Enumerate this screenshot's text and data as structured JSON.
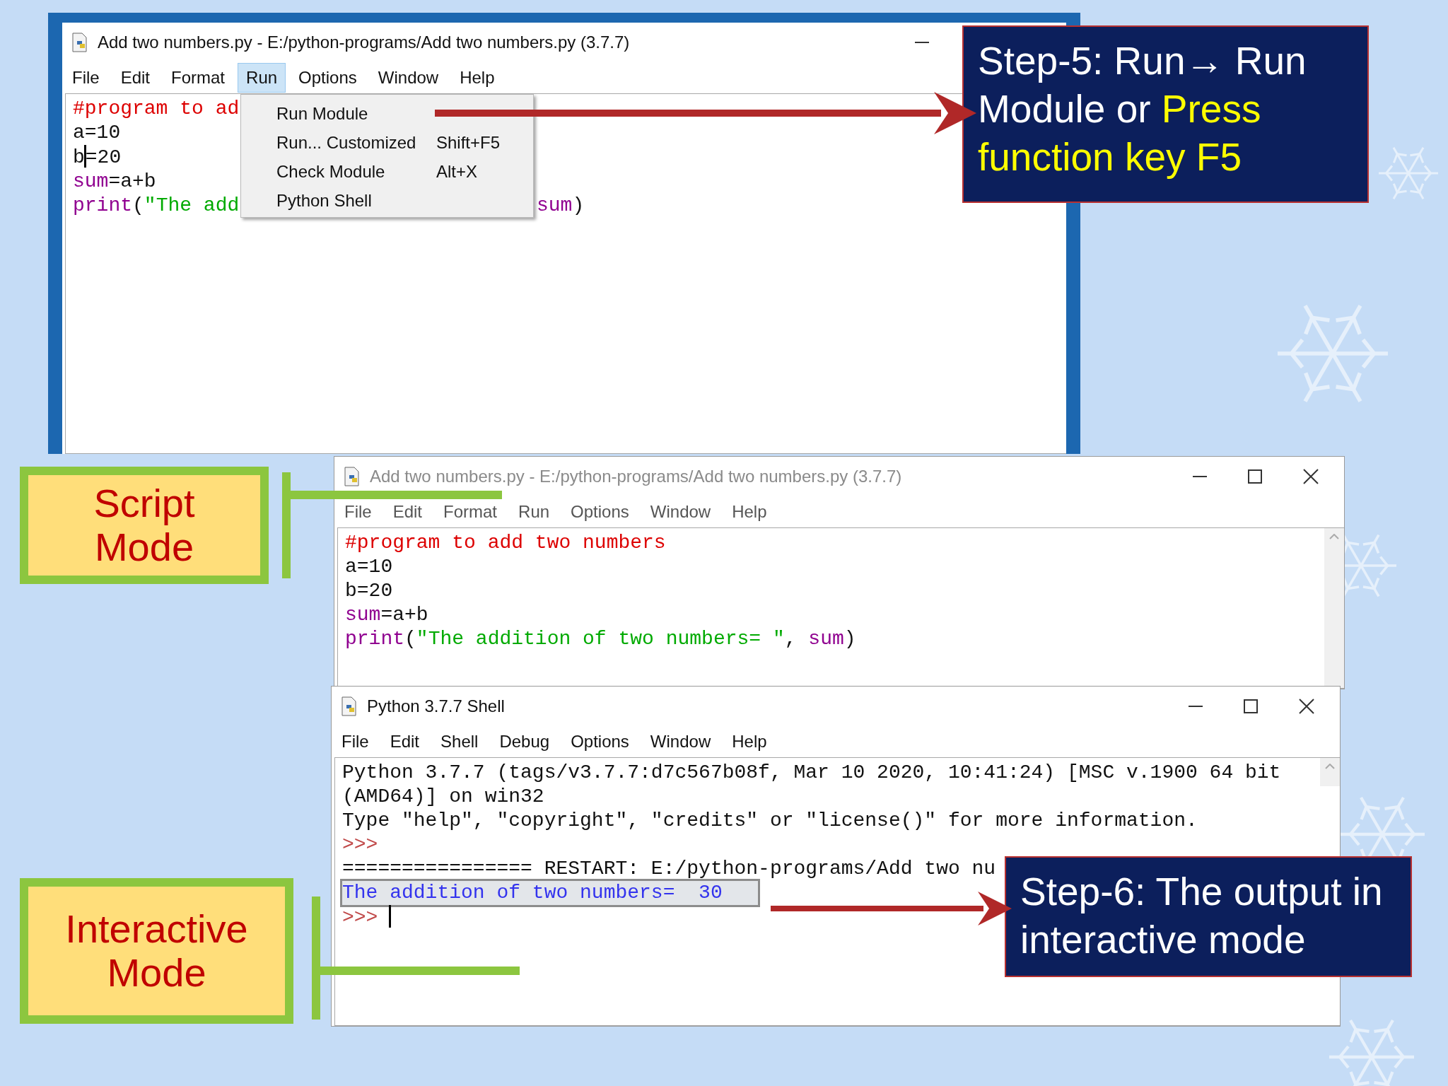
{
  "editor_window": {
    "title": "Add two numbers.py - E:/python-programs/Add two numbers.py (3.7.7)",
    "active": true,
    "menu": [
      {
        "label": "File",
        "selected": false
      },
      {
        "label": "Edit",
        "selected": false
      },
      {
        "label": "Format",
        "selected": false
      },
      {
        "label": "Run",
        "selected": true
      },
      {
        "label": "Options",
        "selected": false
      },
      {
        "label": "Window",
        "selected": false
      },
      {
        "label": "Help",
        "selected": false
      }
    ],
    "code_lines": [
      {
        "tokens": [
          {
            "text": "#program to ad",
            "kind": "comment"
          }
        ]
      },
      {
        "tokens": [
          {
            "text": "a=10",
            "kind": "plain"
          }
        ]
      },
      {
        "tokens": [
          {
            "text": "b",
            "kind": "plain"
          },
          {
            "kind": "cursor"
          },
          {
            "text": "=20",
            "kind": "plain"
          }
        ]
      },
      {
        "tokens": [
          {
            "text": "sum",
            "kind": "builtin"
          },
          {
            "text": "=a+b",
            "kind": "plain"
          }
        ]
      },
      {
        "tokens": [
          {
            "text": "print",
            "kind": "builtin"
          },
          {
            "text": "(",
            "kind": "plain"
          },
          {
            "text": "\"The add",
            "kind": "string"
          }
        ],
        "tail": [
          {
            "text": "sum",
            "kind": "builtin"
          },
          {
            "text": ")",
            "kind": "plain"
          }
        ]
      }
    ]
  },
  "run_menu": {
    "items": [
      {
        "label": "Run Module"
      },
      {
        "label": "Run... Customized",
        "shortcut": "Shift+F5"
      },
      {
        "label": "Check Module",
        "shortcut": "Alt+X"
      },
      {
        "label": "Python Shell"
      }
    ]
  },
  "callout_step5": {
    "segments": [
      {
        "text": "Step-5: Run→ Run Module or ",
        "highlight": false
      },
      {
        "text": "Press function key F5",
        "highlight": true
      }
    ]
  },
  "script_mode_label": "Script Mode",
  "script_window": {
    "title": "Add two numbers.py - E:/python-programs/Add two numbers.py (3.7.7)",
    "active": false,
    "menu": [
      {
        "label": "File",
        "selected": false
      },
      {
        "label": "Edit",
        "selected": false
      },
      {
        "label": "Format",
        "selected": false
      },
      {
        "label": "Run",
        "selected": false
      },
      {
        "label": "Options",
        "selected": false
      },
      {
        "label": "Window",
        "selected": false
      },
      {
        "label": "Help",
        "selected": false
      }
    ],
    "code_lines": [
      {
        "tokens": [
          {
            "text": "#program to add two numbers",
            "kind": "comment"
          }
        ]
      },
      {
        "tokens": [
          {
            "text": "a=10",
            "kind": "plain"
          }
        ]
      },
      {
        "tokens": [
          {
            "text": "b=20",
            "kind": "plain"
          }
        ]
      },
      {
        "tokens": [
          {
            "text": "sum",
            "kind": "builtin"
          },
          {
            "text": "=a+b",
            "kind": "plain"
          }
        ]
      },
      {
        "tokens": [
          {
            "text": "print",
            "kind": "builtin"
          },
          {
            "text": "(",
            "kind": "plain"
          },
          {
            "text": "\"The addition of two numbers= \"",
            "kind": "string"
          },
          {
            "text": ", ",
            "kind": "plain"
          },
          {
            "text": "sum",
            "kind": "builtin"
          },
          {
            "text": ")",
            "kind": "plain"
          }
        ]
      }
    ]
  },
  "shell_window": {
    "title": "Python 3.7.7 Shell",
    "active": true,
    "menu": [
      {
        "label": "File",
        "selected": false
      },
      {
        "label": "Edit",
        "selected": false
      },
      {
        "label": "Shell",
        "selected": false
      },
      {
        "label": "Debug",
        "selected": false
      },
      {
        "label": "Options",
        "selected": false
      },
      {
        "label": "Window",
        "selected": false
      },
      {
        "label": "Help",
        "selected": false
      }
    ],
    "lines": [
      {
        "tokens": [
          {
            "text": "Python 3.7.7 (tags/v3.7.7:d7c567b08f, Mar 10 2020, 10:41:24) [MSC v.1900 64 bit",
            "kind": "plain"
          }
        ]
      },
      {
        "tokens": [
          {
            "text": "(AMD64)] on win32",
            "kind": "plain"
          }
        ]
      },
      {
        "tokens": [
          {
            "text": "Type \"help\", \"copyright\", \"credits\" or \"license()\" for more information.",
            "kind": "plain"
          }
        ]
      },
      {
        "tokens": [
          {
            "text": ">>>",
            "kind": "prompt"
          }
        ]
      },
      {
        "tokens": [
          {
            "text": "================ RESTART: E:/python-programs/Add two nu",
            "kind": "plain"
          }
        ]
      },
      {
        "tokens": [
          {
            "text": "The addition of two numbers=  30",
            "kind": "output"
          }
        ],
        "highlighted": true
      },
      {
        "tokens": [
          {
            "text": ">>> ",
            "kind": "prompt"
          },
          {
            "kind": "cursor"
          }
        ]
      }
    ]
  },
  "callout_step6": "Step-6: The output in interactive mode",
  "interactive_mode_label": "Interactive Mode"
}
